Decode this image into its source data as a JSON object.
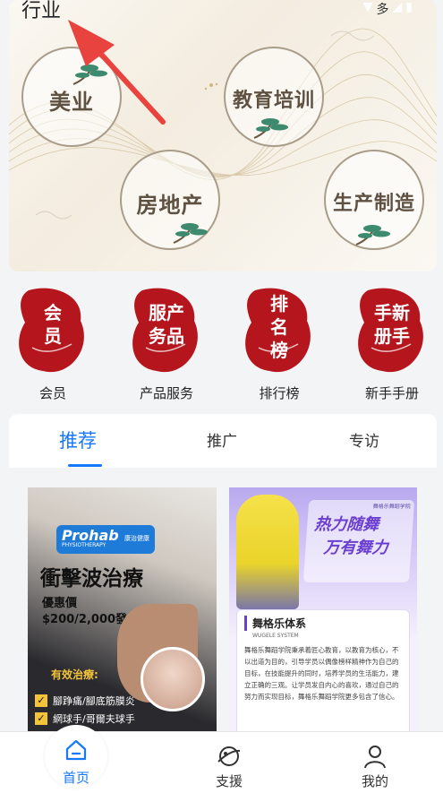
{
  "status_bar": {
    "title": "行业",
    "icons_text": "多"
  },
  "industries": [
    {
      "label": "美业"
    },
    {
      "label": "教育培训"
    },
    {
      "label": "房地产"
    },
    {
      "label": "生产制造"
    }
  ],
  "quick_links": [
    {
      "ink_text": "会员",
      "label": "会员"
    },
    {
      "ink_text": "服产务品",
      "label": "产品服务"
    },
    {
      "ink_text": "排名榜",
      "label": "排行榜"
    },
    {
      "ink_text": "手新册手",
      "label": "新手手册"
    }
  ],
  "tabs": [
    {
      "label": "推荐",
      "active": true
    },
    {
      "label": "推广",
      "active": false
    },
    {
      "label": "专访",
      "active": false
    }
  ],
  "cards": [
    {
      "brand": "Prohab",
      "brand_cn": "康治健康",
      "brand_sub": "PHYSIOTHERAPY",
      "headline": "衝擊波治療",
      "price_label": "優惠價",
      "price": "$200/2,000發",
      "section": "有效治療:",
      "items": [
        "腳踭痛/腳底筋膜炎",
        "網球手/哥爾夫球手"
      ]
    },
    {
      "banner_line1": "热力随舞",
      "banner_line2": "万有舞力",
      "school": "舞格乐舞蹈学院",
      "title": "舞格乐体系",
      "subtitle": "WUGELE SYSTEM",
      "body": "舞格乐舞蹈学院秉承着匠心教育，以教育为核心，不以出道为目的，引导学员以偶像榜样精神作为自己的目标，在技能提升的同时，培养学员的生活能力，建立正确的三观。让学员发自内心的喜欢，通过自己的努力而实现目标，舞格乐舞蹈学院更多包含了信心。"
    }
  ],
  "bottom_nav": [
    {
      "label": "首页",
      "icon": "home-icon",
      "active": true
    },
    {
      "label": "支援",
      "icon": "planet-icon",
      "active": false
    },
    {
      "label": "我的",
      "icon": "user-icon",
      "active": false
    }
  ],
  "colors": {
    "accent": "#1677ff",
    "ink_red": "#b5161d",
    "gold": "#a99d8a"
  }
}
